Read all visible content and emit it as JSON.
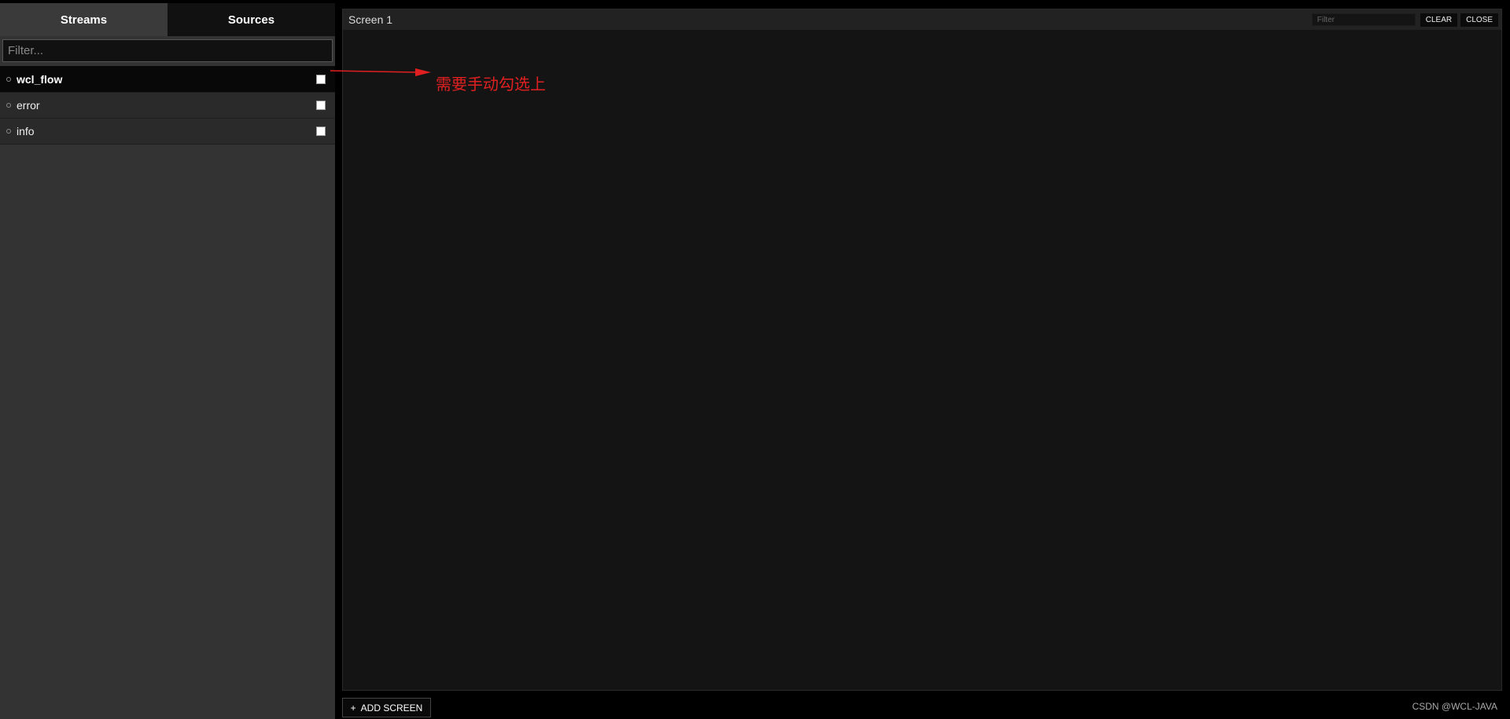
{
  "sidebar": {
    "tabs": [
      {
        "label": "Streams"
      },
      {
        "label": "Sources"
      }
    ],
    "filter_placeholder": "Filter...",
    "streams": [
      {
        "name": "wcl_flow"
      },
      {
        "name": "error"
      },
      {
        "name": "info"
      }
    ]
  },
  "screen": {
    "title": "Screen 1",
    "filter_placeholder": "Filter",
    "clear_label": "CLEAR",
    "close_label": "CLOSE"
  },
  "annotation": {
    "text": "需要手动勾选上",
    "color": "#e02020"
  },
  "footer": {
    "add_screen_label": "ADD SCREEN",
    "add_screen_icon": "+",
    "watermark": "CSDN @WCL-JAVA"
  }
}
